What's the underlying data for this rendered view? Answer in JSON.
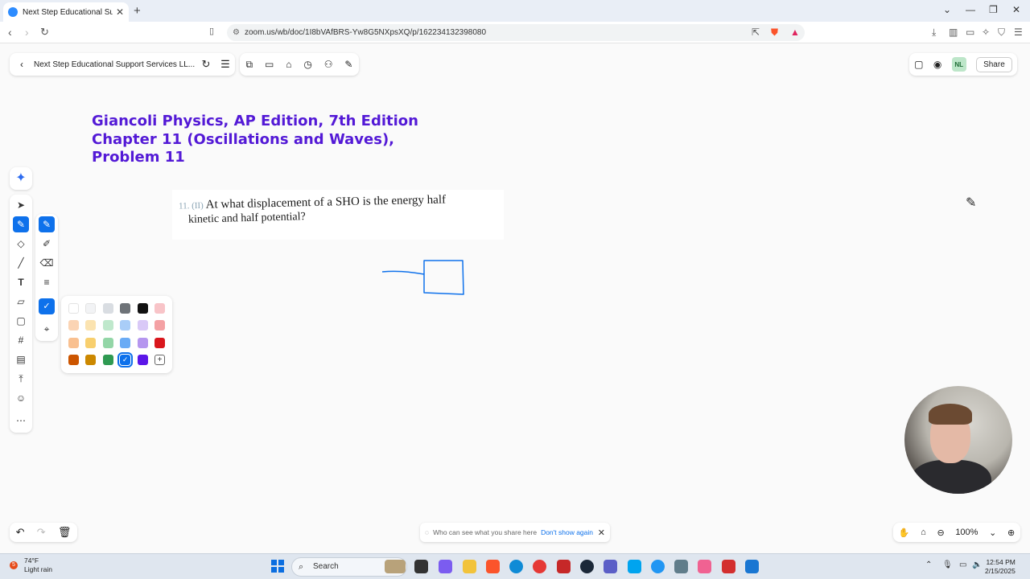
{
  "browser": {
    "tab_title": "Next Step Educational Support",
    "url": "zoom.us/wb/doc/1I8bVAfBRS-Yw8G5NXpsXQ/p/162234132398080"
  },
  "whiteboard": {
    "doc_title": "Next Step Educational Support Services LL...",
    "avatar_initials": "NL",
    "share_label": "Share",
    "zoom_level": "100%"
  },
  "heading": {
    "line1": "Giancoli Physics, AP Edition, 7th Edition",
    "line2": "Chapter 11 (Oscillations and Waves),",
    "line3": "Problem 11"
  },
  "problem": {
    "number": "11. (II)",
    "line1": "At what displacement of a SHO is the energy half",
    "line2": "kinetic and half potential?"
  },
  "palette": {
    "colors": [
      "#ffffff",
      "#f2f3f5",
      "#d9dde2",
      "#6e7378",
      "#111111",
      "#f8c4c8",
      "#fbd4b4",
      "#fbe3b0",
      "#bfe8cc",
      "#a9cdf8",
      "#d9c9f7",
      "#f4a1a4",
      "#f9c090",
      "#f8cf6e",
      "#93d6a7",
      "#6aabf5",
      "#b596ef",
      "#d9161c",
      "#cc5500",
      "#cc8800",
      "#2f9a52",
      "#0e71eb",
      "#5b16e8"
    ],
    "selected": "#0e71eb",
    "highlight_color": "#5319d6"
  },
  "notice": {
    "text": "Who can see what you share here",
    "link": "Don't show again"
  },
  "taskbar": {
    "temperature": "74°F",
    "weather": "Light rain",
    "weather_badge": "5",
    "search_placeholder": "Search",
    "time": "12:54 PM",
    "date": "2/15/2025"
  }
}
